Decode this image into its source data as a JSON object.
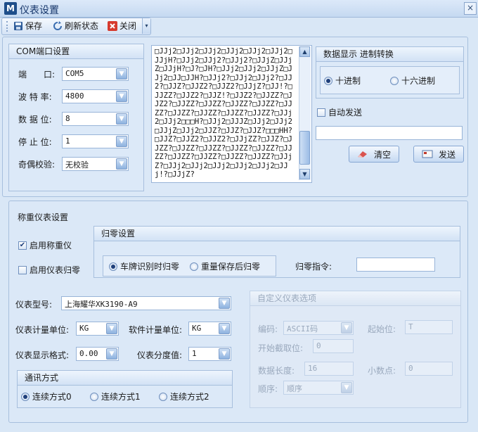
{
  "window": {
    "title": "仪表设置",
    "app_icon": "M",
    "close_glyph": "×"
  },
  "toolbar": {
    "save_label": "保存",
    "refresh_label": "刷新状态",
    "close_label": "关闭",
    "dropdown_glyph": "▾"
  },
  "com_settings": {
    "title": "COM端口设置",
    "port_label": "端　　口:",
    "port_value": "COM5",
    "baud_label": "波 特 率:",
    "baud_value": "4800",
    "databits_label": "数 据 位:",
    "databits_value": "8",
    "stopbits_label": "停 止 位:",
    "stopbits_value": "1",
    "parity_label": "奇偶校验:",
    "parity_value": "无校验"
  },
  "receive_log": {
    "text": "□JJj2□JJj2□JJj2□JJj2□JJj2□JJj2□JJjH?□JJj2□JJj2?□JJj2?□JJjZ□JJjZ□JJjH?□J?□JH?□JJj2□JJj2□JJjZ□JJj2□JJ□JJH?□JJj2?□JJj2□JJj2?□JJ2?□JJZ?□JJZ2?□JJZ2?□JJjZ?□JJ!?□JJZZ?□JJZ2?□JJZ!?□JJZ2?□JJZZ?□JJZ2?□JJZZ?□JJZZ?□JJZZ?□JJZZ?□JJZZ?□JJZZ?□JJZZ?□JJZZ?□JJZZ?□JJj2□JJj2□□□H?□JJj2□JJJZ□JJj2□JJj2□JJjZ□JJj2□JJZ?□JJZ?□JJZ?□□□HH?□JJZ?□JJZ2?□JJZ2?□JJjZZ?□JJZ?□JJZZ?□JJZZ?□JJZZ?□JJZZ?□JJZZ?□JJZZ?□JJZZ?□JJZZ?□JJZZ?□JJZZ?□JJjZ?□JJj2□JJj2□JJj2□JJj2□JJj2□JJj!?□JJjZ?",
    "scroll_up": "▲",
    "scroll_down": "▼"
  },
  "display_mode": {
    "title": "数据显示 进制转换",
    "decimal_label": "十进制",
    "hex_label": "十六进制",
    "selected": "decimal"
  },
  "send": {
    "auto_send_label": "自动发送",
    "input_value": "",
    "clear_label": "清空",
    "send_label": "发送"
  },
  "scale_settings": {
    "title": "称重仪表设置",
    "enable_scale_label": "启用称重仪",
    "enable_scale_checked": true,
    "enable_zero_label": "启用仪表归零",
    "enable_zero_checked": false,
    "zero_settings": {
      "title": "归零设置",
      "option1_label": "车牌识别时归零",
      "option2_label": "重量保存后归零",
      "selected": "option1",
      "command_label": "归零指令:",
      "command_value": ""
    },
    "model_label": "仪表型号:",
    "model_value": "上海耀华XK3190-A9",
    "meter_unit_label": "仪表计量单位:",
    "meter_unit_value": "KG",
    "software_unit_label": "软件计量单位:",
    "software_unit_value": "KG",
    "display_format_label": "仪表显示格式:",
    "display_format_value": "0.00",
    "division_label": "仪表分度值:",
    "division_value": "1",
    "comm_mode": {
      "title": "通讯方式",
      "mode0_label": "连续方式0",
      "mode1_label": "连续方式1",
      "mode2_label": "连续方式2",
      "selected": "mode0"
    }
  },
  "custom_options": {
    "title": "自定义仪表选项",
    "encoding_label": "编码:",
    "encoding_value": "ASCII码",
    "start_bit_label": "起始位:",
    "start_bit_value": "T",
    "start_pos_label": "开始截取位:",
    "start_pos_value": "0",
    "data_length_label": "数据长度:",
    "data_length_value": "16",
    "decimal_label": "小数点:",
    "decimal_value": "0",
    "order_label": "顺序:",
    "order_value": "顺序"
  },
  "colors": {
    "background": "#d9e7f6",
    "accent": "#1e4e8a",
    "border": "#a7bfdd"
  }
}
